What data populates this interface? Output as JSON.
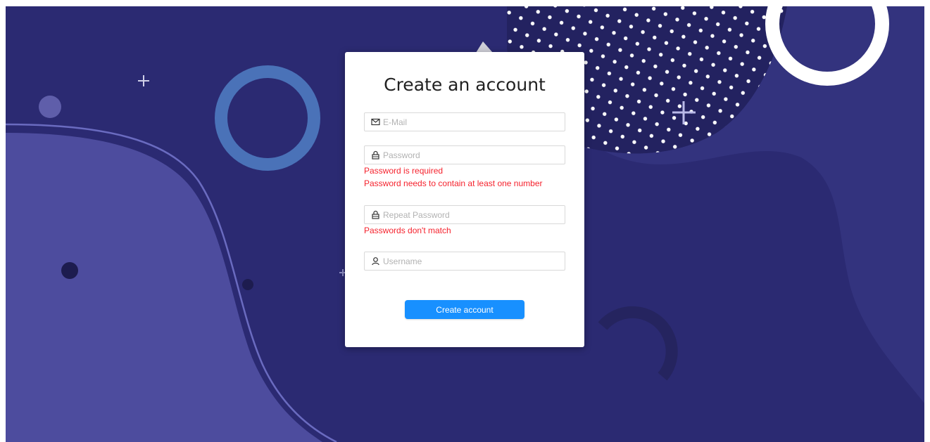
{
  "form": {
    "title": "Create an account",
    "email": {
      "placeholder": "E-Mail",
      "icon": "mail-icon"
    },
    "password": {
      "placeholder": "Password",
      "icon": "lock-icon",
      "errors": [
        "Password is required",
        "Password needs to contain at least one number"
      ]
    },
    "repeat_password": {
      "placeholder": "Repeat Password",
      "icon": "lock-icon",
      "error": "Passwords don't match"
    },
    "username": {
      "placeholder": "Username",
      "icon": "user-icon"
    },
    "submit_label": "Create account"
  },
  "colors": {
    "background": "#2b2a72",
    "accent": "#1890ff",
    "error": "#f5222d",
    "light_blob": "#4e4d9e",
    "ring_blue": "#4a72b8"
  }
}
